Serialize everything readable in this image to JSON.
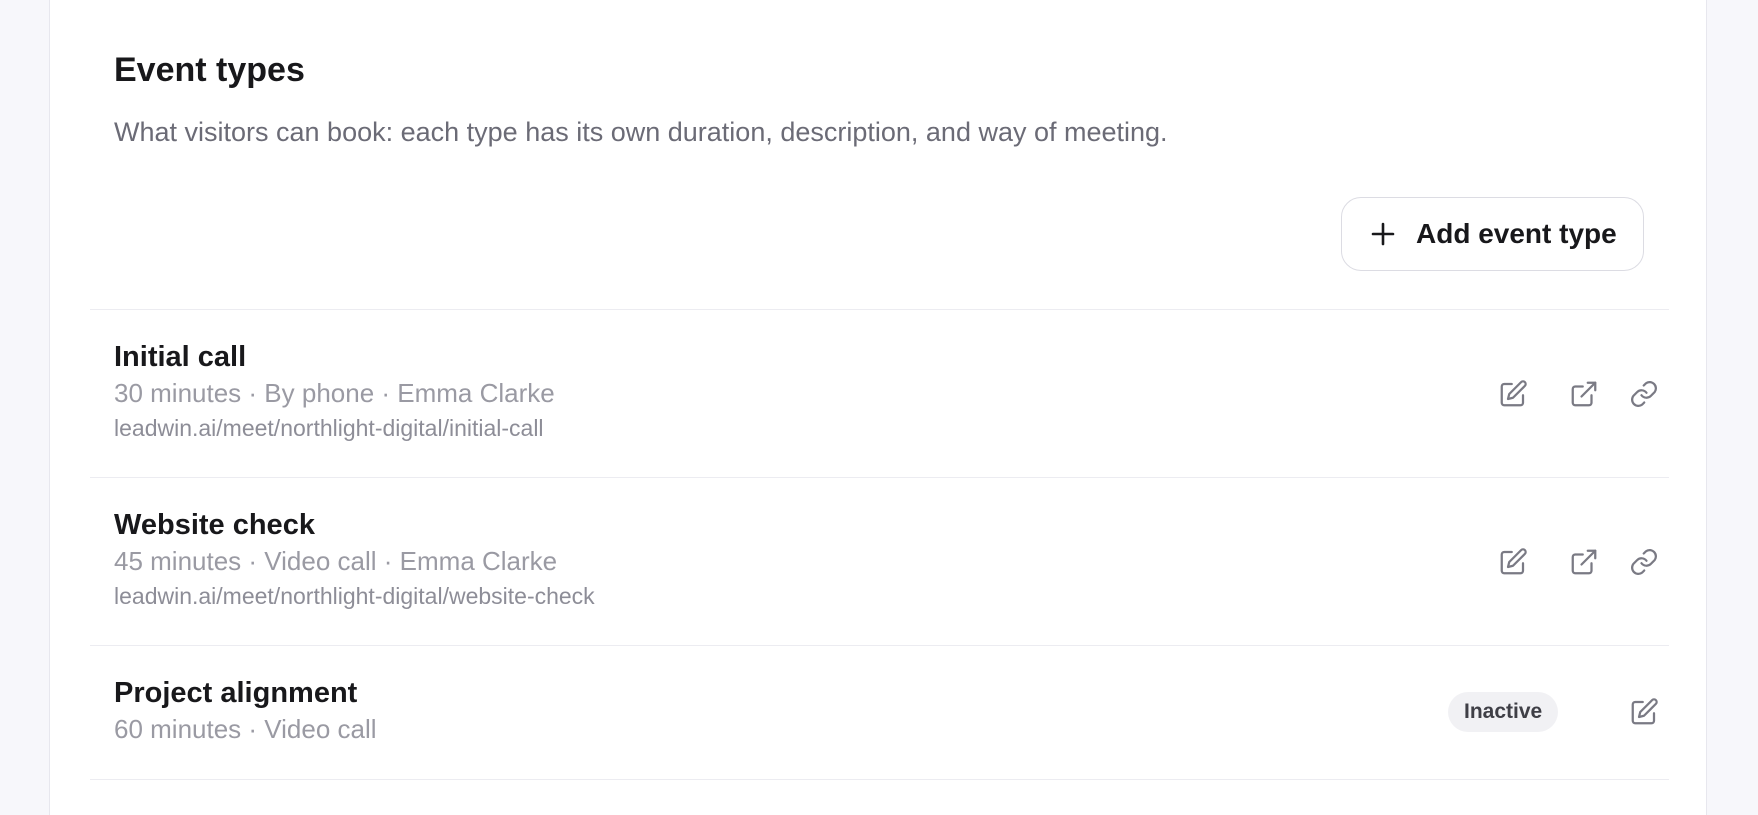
{
  "section": {
    "title": "Event types",
    "subtitle": "What visitors can book: each type has its own duration, description, and way of meeting.",
    "add_button_label": "Add event type"
  },
  "event_types": [
    {
      "name": "Initial call",
      "meta": "30 minutes · By phone · Emma Clarke",
      "url": "leadwin.ai/meet/northlight-digital/initial-call",
      "status": ""
    },
    {
      "name": "Website check",
      "meta": "45 minutes · Video call · Emma Clarke",
      "url": "leadwin.ai/meet/northlight-digital/website-check",
      "status": ""
    },
    {
      "name": "Project alignment",
      "meta": "60 minutes · Video call",
      "url": "",
      "status": "Inactive"
    }
  ],
  "icons": {
    "edit": "edit-icon",
    "open": "external-link-icon",
    "copy": "link-icon",
    "add": "plus-icon"
  },
  "colors": {
    "icon": "#7a7a84",
    "muted_text": "#9a9aa3",
    "badge_bg": "#f1f1f4"
  }
}
